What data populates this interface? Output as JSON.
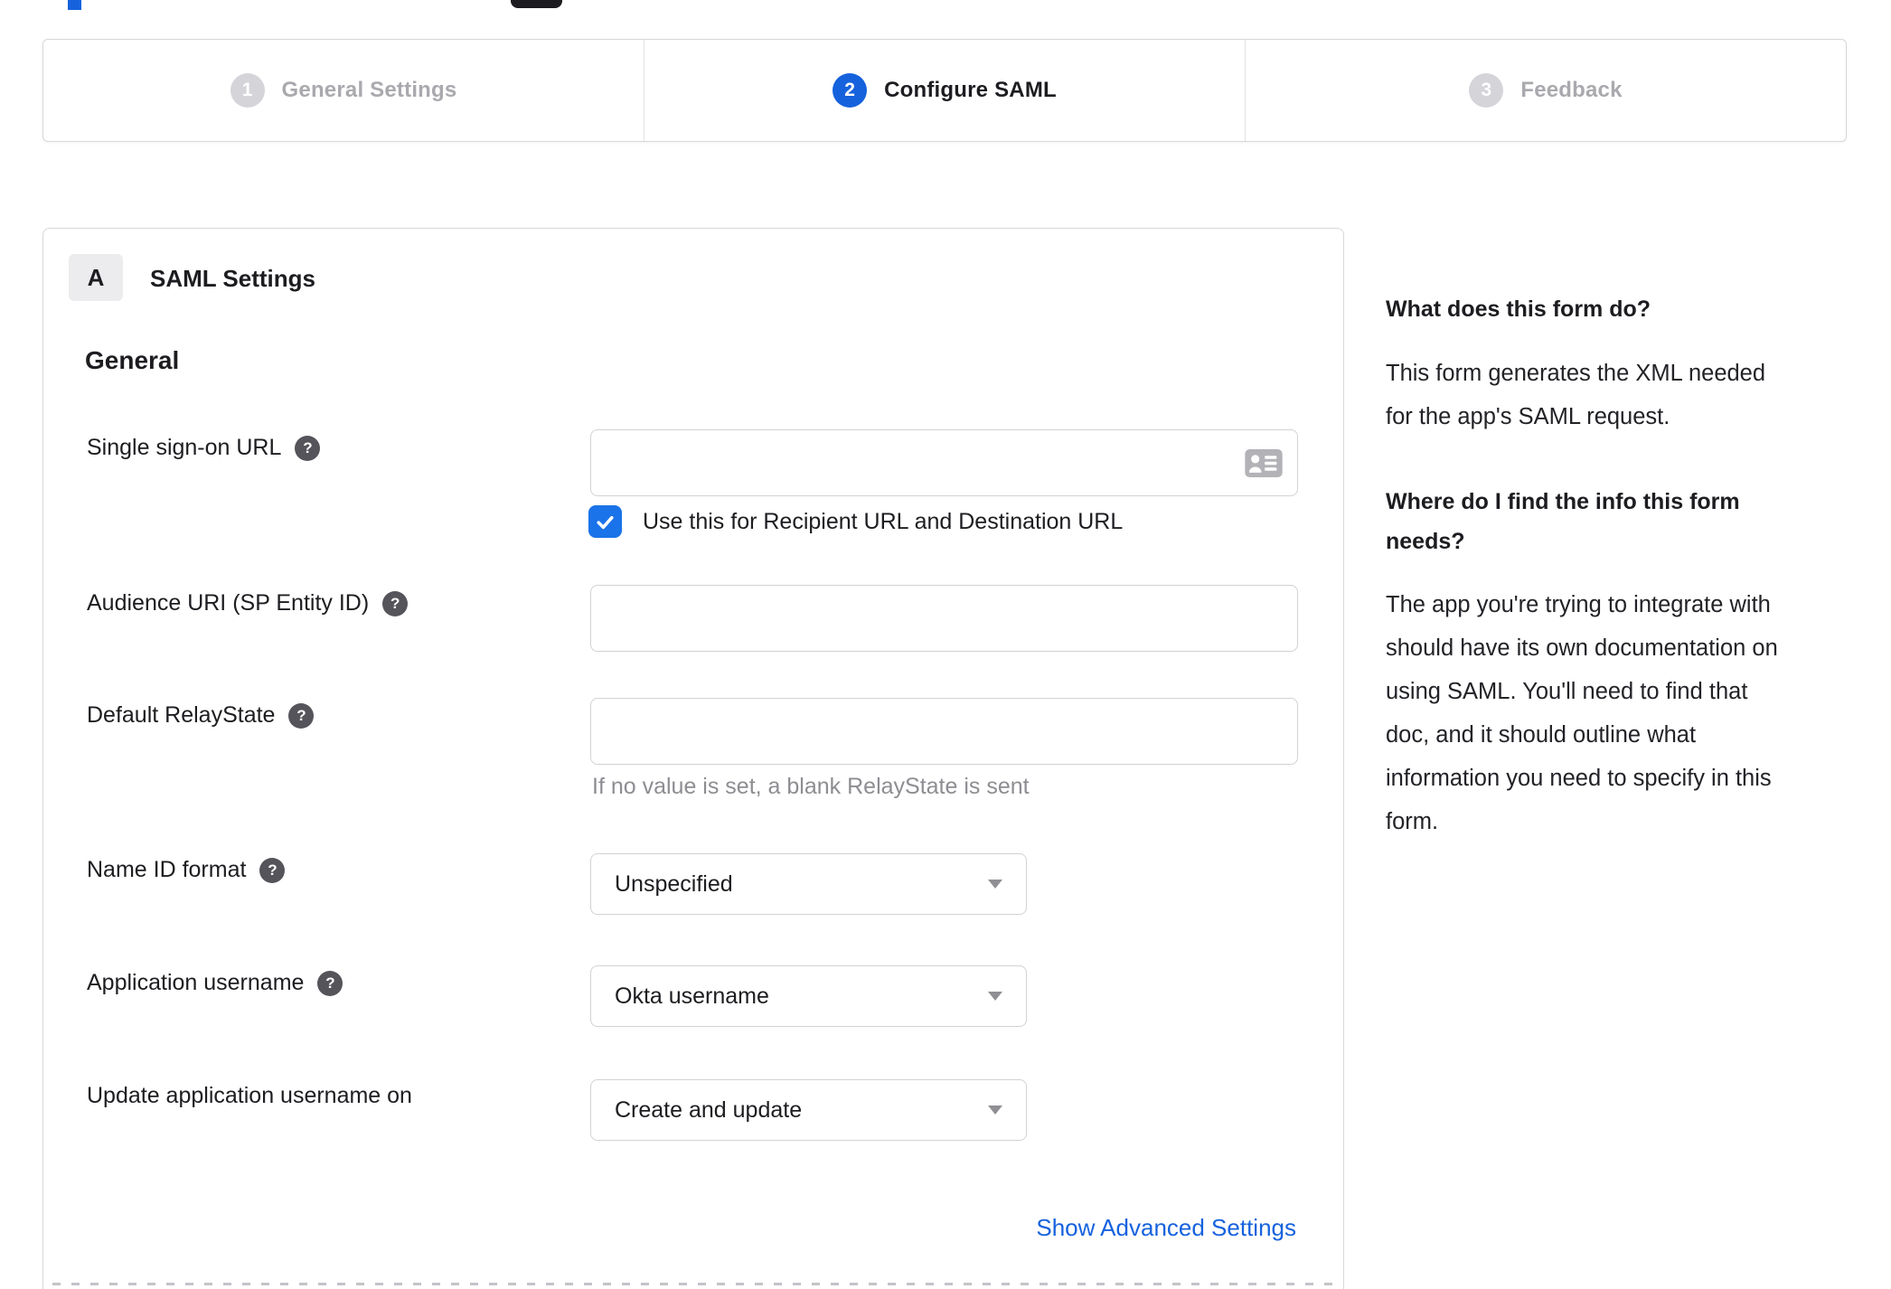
{
  "colors": {
    "accent_blue": "#1662dd",
    "checkbox_blue": "#1a73e8",
    "link_blue": "#1662dd",
    "border_gray": "#d7d7dc",
    "text_dark": "#1d1d21",
    "muted_gray": "#8d8d92"
  },
  "stepper": {
    "steps": [
      {
        "number": "1",
        "label": "General Settings"
      },
      {
        "number": "2",
        "label": "Configure SAML"
      },
      {
        "number": "3",
        "label": "Feedback"
      }
    ]
  },
  "panel": {
    "badge": "A",
    "title": "SAML Settings",
    "group_title": "General",
    "fields": {
      "sso": {
        "label": "Single sign-on URL",
        "value": "",
        "checkbox_label": "Use this for Recipient URL and Destination URL",
        "checkbox_checked": "true"
      },
      "audience": {
        "label": "Audience URI (SP Entity ID)",
        "value": ""
      },
      "relay": {
        "label": "Default RelayState",
        "value": "",
        "helper": "If no value is set, a blank RelayState is sent"
      },
      "nameid": {
        "label": "Name ID format",
        "value": "Unspecified"
      },
      "appuser": {
        "label": "Application username",
        "value": "Okta username"
      },
      "updateuser": {
        "label": "Update application username on",
        "value": "Create and update"
      }
    },
    "advanced_link": "Show Advanced Settings"
  },
  "sidebar": {
    "heading1": "What does this form do?",
    "body1": "This form generates the XML needed\nfor the app's SAML request.",
    "heading2": "Where do I find the info this form\nneeds?",
    "body2": "The app you're trying to integrate with\nshould have its own documentation on\nusing SAML. You'll need to find that\ndoc, and it should outline what\ninformation you need to specify in this\nform."
  }
}
